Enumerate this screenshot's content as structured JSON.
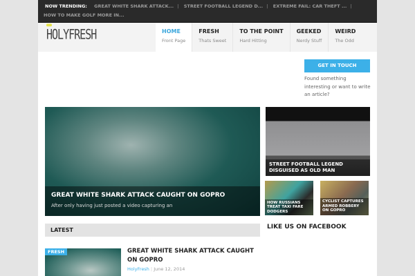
{
  "trending": {
    "label": "NOW TRENDING:",
    "items": [
      "GREAT WHITE SHARK ATTACK...",
      "STREET FOOTBALL LEGEND D...",
      "EXTREME FAIL: CAR THEFT ...",
      "HOW TO MAKE GOLF MORE IN..."
    ]
  },
  "logo": "HOLYFRESH",
  "nav": [
    {
      "title": "HOME",
      "sub": "Front Page"
    },
    {
      "title": "FRESH",
      "sub": "Thats Sweet"
    },
    {
      "title": "TO THE POINT",
      "sub": "Hard Hitting"
    },
    {
      "title": "GEEKED",
      "sub": "Nerdy Stuff"
    },
    {
      "title": "WEIRD",
      "sub": "The Odd"
    }
  ],
  "cta": {
    "button": "GET IN TOUCH",
    "text": "Found something interesting or want to write an article?"
  },
  "featured": {
    "title": "GREAT WHITE SHARK ATTACK CAUGHT ON GOPRO",
    "excerpt": "After only having just posted a video capturing an"
  },
  "side_big": "STREET FOOTBALL LEGEND DISGUISED AS OLD MAN",
  "side_small": [
    "HOW RUSSIANS TREAT TAXI FARE DODGERS",
    "CYCLIST CAPTURES ARMED ROBBERY ON GOPRO"
  ],
  "latest": {
    "heading": "LATEST",
    "post": {
      "badge": "FRESH",
      "title": "GREAT WHITE SHARK ATTACK CAUGHT ON GOPRO",
      "author": "HolyFresh",
      "date": "June 12, 2014"
    }
  },
  "facebook": "LIKE US ON FACEBOOK"
}
